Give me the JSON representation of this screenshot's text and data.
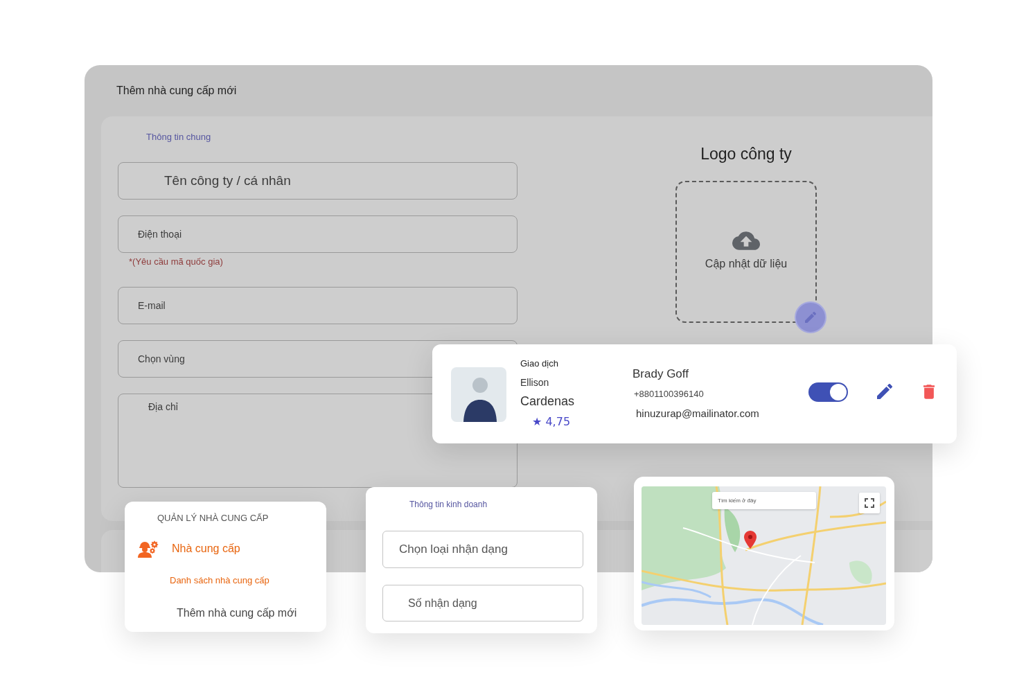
{
  "form_panel": {
    "title": "Thêm nhà cung cấp mới",
    "section_title": "Thông tin chung",
    "fields": [
      {
        "kind": "large-input",
        "placeholder": "Tên công ty / cá nhân"
      },
      {
        "kind": "input",
        "placeholder": "Điện thoại",
        "hint": "*(Yêu cầu mã quốc gia)"
      },
      {
        "kind": "input",
        "placeholder": "E-mail"
      },
      {
        "kind": "input",
        "placeholder": "Chọn vùng"
      },
      {
        "kind": "textarea",
        "placeholder": "Địa chỉ"
      }
    ],
    "logo": {
      "title": "Logo công ty",
      "upload_label": "Cập nhật dữ liệu"
    }
  },
  "contact_card": {
    "caption": "Giao dịch",
    "first_name": "Ellison",
    "last_name": "Cardenas",
    "rating": "★ 4,75",
    "full_name": "Brady Goff",
    "phone": "+8801100396140",
    "email": "hinuzurap@mailinator.com",
    "active": true
  },
  "nav_card": {
    "heading": "QUẢN LÝ NHÀ CUNG CẤP",
    "items": [
      {
        "kind": "group",
        "label": "Nhà cung cấp",
        "selected": true
      },
      {
        "kind": "small-link",
        "label": "Danh sách nhà cung cấp",
        "selected": true
      },
      {
        "kind": "link",
        "label": "Thêm nhà cung cấp mới",
        "selected": false
      }
    ]
  },
  "business_card": {
    "section_title": "Thông tin kinh doanh",
    "fields": [
      {
        "kind": "large-input",
        "placeholder": "Chọn loại nhận dạng"
      },
      {
        "kind": "input",
        "placeholder": "Số nhận dạng"
      }
    ]
  },
  "map_card": {
    "search": {
      "placeholder": "Tìm kiếm ở đây"
    }
  }
}
